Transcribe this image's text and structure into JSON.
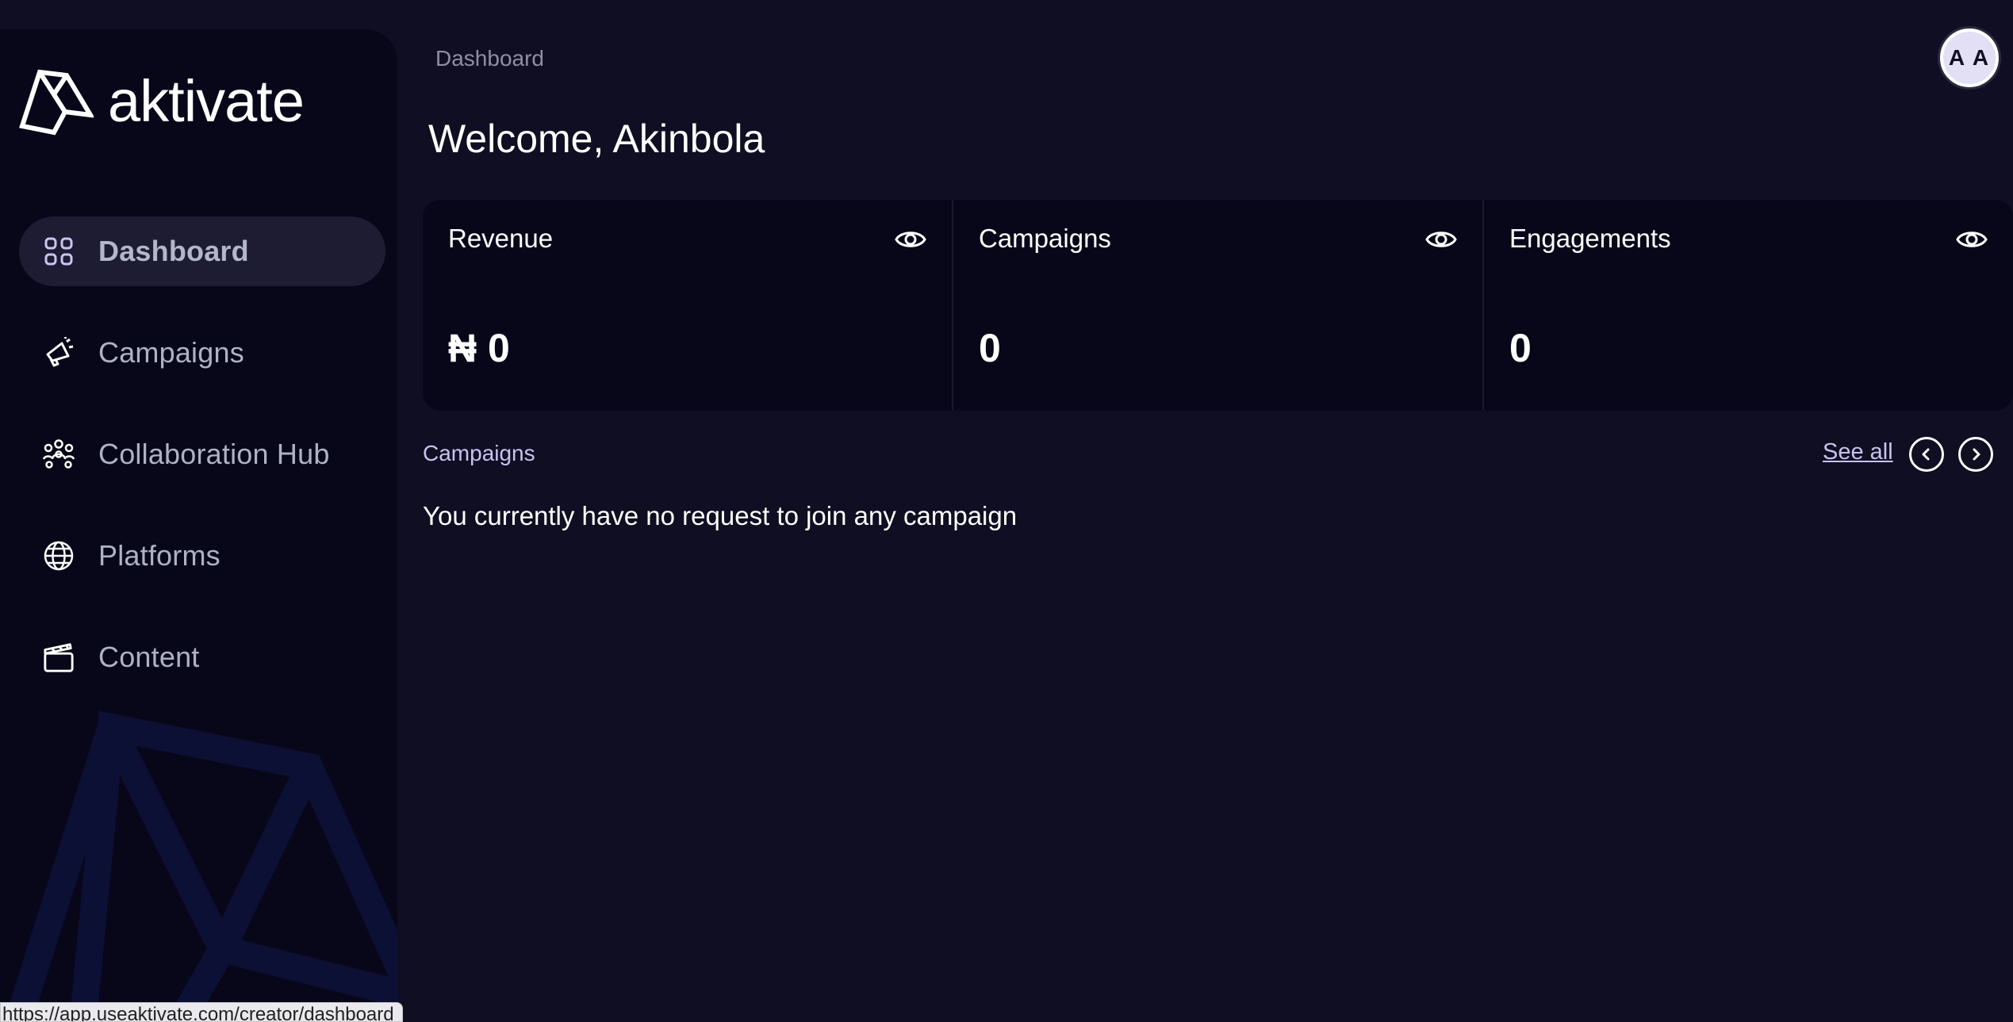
{
  "brand": {
    "name": "aktivate"
  },
  "sidebar": {
    "items": [
      {
        "label": "Dashboard",
        "icon": "grid-icon",
        "active": true
      },
      {
        "label": "Campaigns",
        "icon": "megaphone-icon",
        "active": false
      },
      {
        "label": "Collaboration Hub",
        "icon": "users-icon",
        "active": false
      },
      {
        "label": "Platforms",
        "icon": "globe-icon",
        "active": false
      },
      {
        "label": "Content",
        "icon": "clapperboard-icon",
        "active": false
      }
    ]
  },
  "header": {
    "breadcrumb": "Dashboard",
    "avatar_initials": "A A",
    "welcome": "Welcome, Akinbola"
  },
  "stats": [
    {
      "title": "Revenue",
      "value": "₦ 0",
      "icon": "eye-icon"
    },
    {
      "title": "Campaigns",
      "value": "0",
      "icon": "eye-icon"
    },
    {
      "title": "Engagements",
      "value": "0",
      "icon": "eye-icon"
    }
  ],
  "campaigns_section": {
    "title": "Campaigns",
    "see_all": "See all",
    "empty_message": "You currently have no request to join any campaign"
  },
  "status_bar": {
    "url": "https://app.useaktivate.com/creator/dashboard"
  },
  "colors": {
    "background": "#0f0e22",
    "sidebar": "#08071a",
    "accent_text": "#c8c2f0",
    "active_nav": "#1d1c33"
  }
}
